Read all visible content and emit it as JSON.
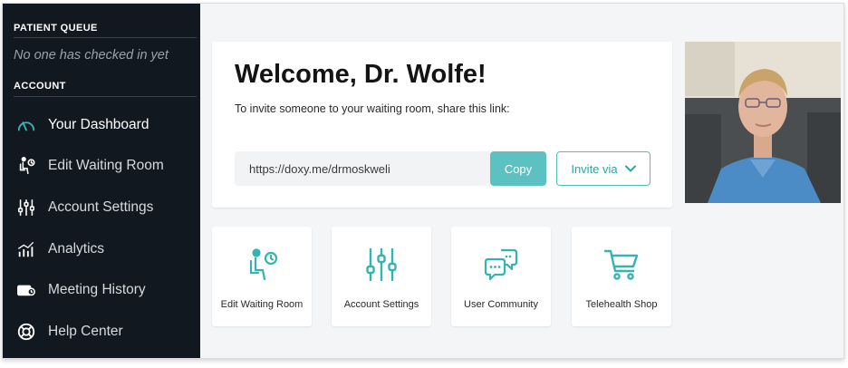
{
  "sidebar": {
    "patient_queue_heading": "PATIENT QUEUE",
    "queue_empty_text": "No one has checked in yet",
    "account_heading": "ACCOUNT",
    "items": [
      {
        "label": "Your Dashboard",
        "icon": "speedometer-icon",
        "active": true
      },
      {
        "label": "Edit Waiting Room",
        "icon": "waiting-room-icon"
      },
      {
        "label": "Account Settings",
        "icon": "sliders-icon"
      },
      {
        "label": "Analytics",
        "icon": "analytics-icon"
      },
      {
        "label": "Meeting History",
        "icon": "camera-icon"
      },
      {
        "label": "Help Center",
        "icon": "lifebuoy-icon"
      }
    ]
  },
  "welcome": {
    "title": "Welcome, Dr. Wolfe!",
    "invite_text": "To invite someone to your waiting room, share this link:",
    "link": "https://doxy.me/drmoskweli",
    "copy_label": "Copy",
    "invite_via_label": "Invite via"
  },
  "tiles": [
    {
      "label": "Edit Waiting Room",
      "icon": "waiting-room-icon"
    },
    {
      "label": "Account Settings",
      "icon": "sliders-icon"
    },
    {
      "label": "User Community",
      "icon": "chat-bubbles-icon"
    },
    {
      "label": "Telehealth Shop",
      "icon": "shopping-cart-icon"
    }
  ],
  "colors": {
    "sidebar_bg": "#111820",
    "accent": "#34b3b3",
    "copy_button": "#5cc1c1",
    "page_bg": "#f3f5f7"
  }
}
